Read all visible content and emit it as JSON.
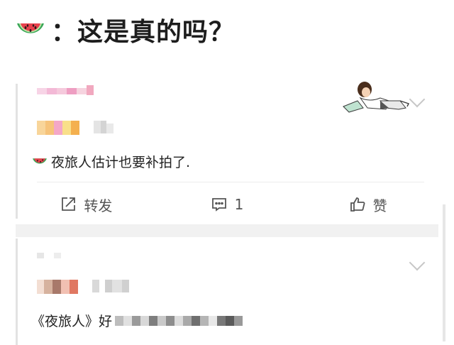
{
  "headline": {
    "icon": "watermelon-icon",
    "text": "：这是真的吗？"
  },
  "comment1": {
    "icon": "watermelon-icon",
    "text": "夜旅人估计也要补拍了."
  },
  "actions": {
    "share_label": "转发",
    "comment_count": "1",
    "like_label": "赞"
  },
  "comment2": {
    "text": "《夜旅人》好"
  },
  "colors": {
    "divider": "#ececec",
    "band": "#f1f1f1",
    "melon_rind": "#3aa657",
    "melon_flesh": "#e8414d"
  }
}
